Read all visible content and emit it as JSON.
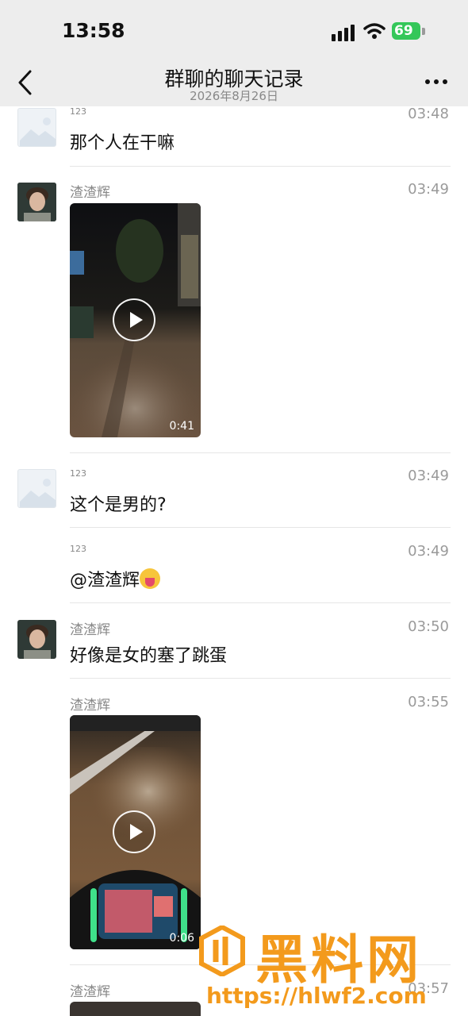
{
  "status": {
    "time": "13:58",
    "battery": "69"
  },
  "nav": {
    "title": "群聊的聊天记录",
    "date": "2026年8月26日"
  },
  "messages": [
    {
      "sender": "123",
      "time": "03:48",
      "text": "那个人在干嘛"
    },
    {
      "sender": "渣渣辉",
      "time": "03:49",
      "video_duration": "0:41"
    },
    {
      "sender": "123",
      "time": "03:49",
      "text": "这个是男的?"
    },
    {
      "sender": "123",
      "time": "03:49",
      "text": "@渣渣辉"
    },
    {
      "sender": "渣渣辉",
      "time": "03:50",
      "text": "好像是女的塞了跳蛋"
    },
    {
      "sender": "渣渣辉",
      "time": "03:55",
      "video_duration": "0:06"
    },
    {
      "sender": "渣渣辉",
      "time": "03:57"
    }
  ],
  "watermark": {
    "brand": "黑料网",
    "url": "https://hlwf2.com"
  }
}
